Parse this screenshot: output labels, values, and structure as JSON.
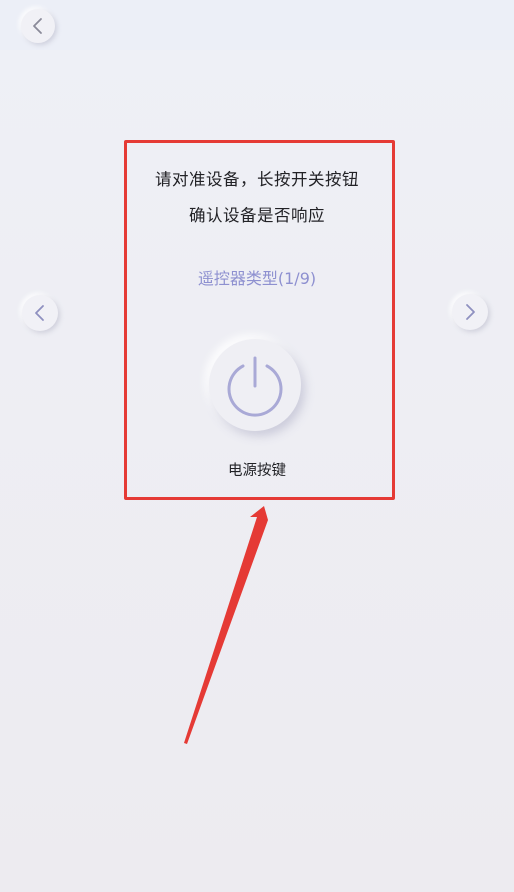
{
  "header": {
    "back_icon": "chevron-left-icon"
  },
  "instruction": {
    "line1": "请对准设备，长按开关按钮",
    "line2": "确认设备是否响应"
  },
  "remote_type": {
    "label": "遥控器类型(1/9)"
  },
  "navigation": {
    "prev_icon": "chevron-left-icon",
    "next_icon": "chevron-right-icon"
  },
  "power_button": {
    "icon": "power-icon",
    "label": "电源按键"
  },
  "annotation": {
    "highlight_color": "#e53a35",
    "arrow_color": "#e53a35"
  },
  "colors": {
    "accent": "#8e90d0",
    "background": "#edebf0"
  }
}
